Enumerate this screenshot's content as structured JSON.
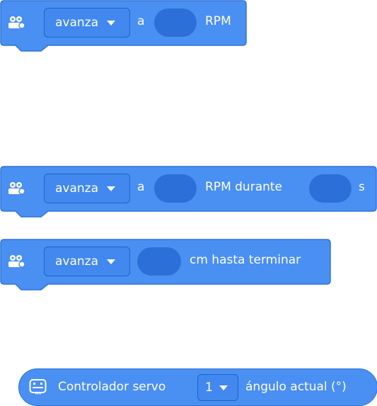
{
  "colors": {
    "block_fill": "#4a8ff2",
    "block_border": "#2f73d6",
    "input_pill": "#2d6fd8",
    "text": "#ffffff"
  },
  "blocks": [
    {
      "icon": "robot-motors-icon",
      "direction": "avanza",
      "a": "a",
      "unit": "RPM"
    },
    {
      "icon": "robot-motors-icon",
      "direction": "avanza",
      "a": "a",
      "unit": "RPM durante",
      "time_unit": "s"
    },
    {
      "icon": "robot-motors-icon",
      "direction": "avanza",
      "text": "cm hasta terminar"
    }
  ],
  "reporter": {
    "icon": "servo-controller-icon",
    "label": "Controlador servo",
    "port": "1",
    "suffix": "ángulo actual (°)"
  }
}
